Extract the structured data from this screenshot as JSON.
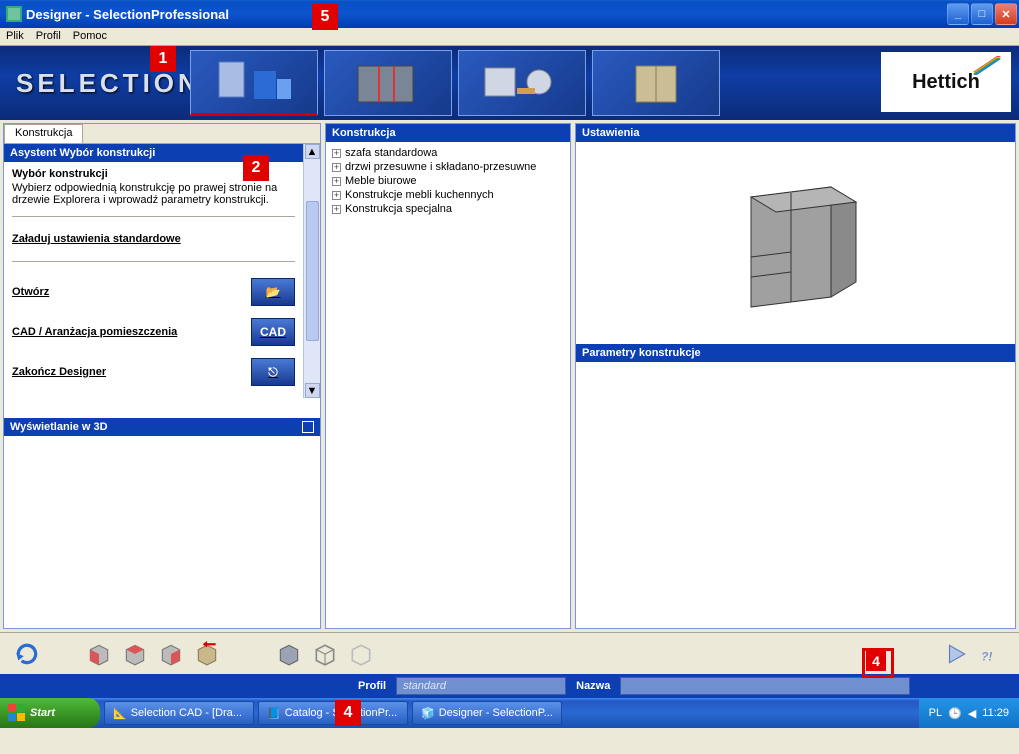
{
  "titlebar": {
    "title": "Designer - SelectionProfessional"
  },
  "menu": {
    "plik": "Plik",
    "profil": "Profil",
    "pomoc": "Pomoc"
  },
  "banner": {
    "text": "SELECTION",
    "logo": "Hettich"
  },
  "left": {
    "tab": "Konstrukcja",
    "assist_header": "Asystent Wybór konstrukcji",
    "wybor_title": "Wybór konstrukcji",
    "wybor_desc": "Wybierz odpowiednią konstrukcję po prawej stronie na drzewie Explorera i wprowadź parametry konstrukcji.",
    "load_std": "Załaduj ustawienia standardowe",
    "open": "Otwórz",
    "cad": "CAD / Aranżacja pomieszczenia",
    "exit": "Zakończ Designer",
    "view3d": "Wyświetlanie w 3D"
  },
  "mid": {
    "header": "Konstrukcja",
    "items": [
      "szafa standardowa",
      "drzwi przesuwne i składano-przesuwne",
      "Meble biurowe",
      "Konstrukcje mebli kuchennych",
      "Konstrukcja specjalna"
    ]
  },
  "right": {
    "settings_header": "Ustawienia",
    "params_header": "Parametry konstrukcje"
  },
  "footer": {
    "profil_label": "Profil",
    "profil_value": "standard",
    "nazwa_label": "Nazwa",
    "nazwa_value": ""
  },
  "taskbar": {
    "start": "Start",
    "tasks": [
      "Selection CAD - [Dra...",
      "Catalog - SelectionPr...",
      "Designer - SelectionP..."
    ],
    "lang": "PL",
    "time": "11:29"
  },
  "markers": {
    "m1": "1",
    "m2": "2",
    "m4a": "4",
    "m4b": "4",
    "m5": "5"
  }
}
